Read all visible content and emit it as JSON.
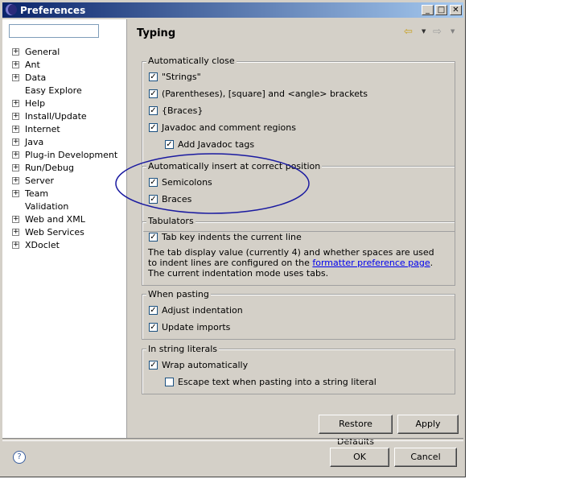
{
  "window": {
    "title": "Preferences",
    "min_icon": "minimize-icon",
    "max_icon": "maximize-icon",
    "close_icon": "close-icon"
  },
  "filter": {
    "value": "",
    "placeholder": ""
  },
  "tree": [
    {
      "label": "General",
      "expandable": true
    },
    {
      "label": "Ant",
      "expandable": true
    },
    {
      "label": "Data",
      "expandable": true
    },
    {
      "label": "Easy Explore",
      "expandable": false
    },
    {
      "label": "Help",
      "expandable": true
    },
    {
      "label": "Install/Update",
      "expandable": true
    },
    {
      "label": "Internet",
      "expandable": true
    },
    {
      "label": "Java",
      "expandable": true
    },
    {
      "label": "Plug-in Development",
      "expandable": true
    },
    {
      "label": "Run/Debug",
      "expandable": true
    },
    {
      "label": "Server",
      "expandable": true
    },
    {
      "label": "Team",
      "expandable": true
    },
    {
      "label": "Validation",
      "expandable": false
    },
    {
      "label": "Web and XML",
      "expandable": true
    },
    {
      "label": "Web Services",
      "expandable": true
    },
    {
      "label": "XDoclet",
      "expandable": true
    }
  ],
  "page": {
    "title": "Typing",
    "groups": {
      "auto_close": {
        "title": "Automatically close",
        "items": [
          {
            "label": "\"Strings\"",
            "checked": true
          },
          {
            "label": "(Parentheses), [square] and <angle> brackets",
            "checked": true
          },
          {
            "label": "{Braces}",
            "checked": true
          },
          {
            "label": "Javadoc and comment regions",
            "checked": true
          },
          {
            "label": "Add Javadoc tags",
            "checked": true
          }
        ]
      },
      "auto_insert": {
        "title": "Automatically insert at correct position",
        "items": [
          {
            "label": "Semicolons",
            "checked": true
          },
          {
            "label": "Braces",
            "checked": true
          }
        ]
      },
      "tabulators": {
        "title": "Tabulators",
        "items": [
          {
            "label": "Tab key indents the current line",
            "checked": true
          }
        ],
        "desc_before": "The tab display value (currently 4) and whether spaces are used to indent lines are configured on the ",
        "desc_link": "formatter preference page",
        "desc_after": ". The current indentation mode uses tabs."
      },
      "pasting": {
        "title": "When pasting",
        "items": [
          {
            "label": "Adjust indentation",
            "checked": true
          },
          {
            "label": "Update imports",
            "checked": true
          }
        ]
      },
      "string_literals": {
        "title": "In string literals",
        "items": [
          {
            "label": "Wrap automatically",
            "checked": true
          },
          {
            "label": "Escape text when pasting into a string literal",
            "checked": false
          }
        ]
      }
    },
    "restore_defaults": "Restore Defaults",
    "apply": "Apply"
  },
  "footer": {
    "ok": "OK",
    "cancel": "Cancel"
  },
  "colors": {
    "annotation_ellipse": "#1a1aa0",
    "titlebar_start": "#0a246a",
    "titlebar_end": "#a6caf0"
  }
}
